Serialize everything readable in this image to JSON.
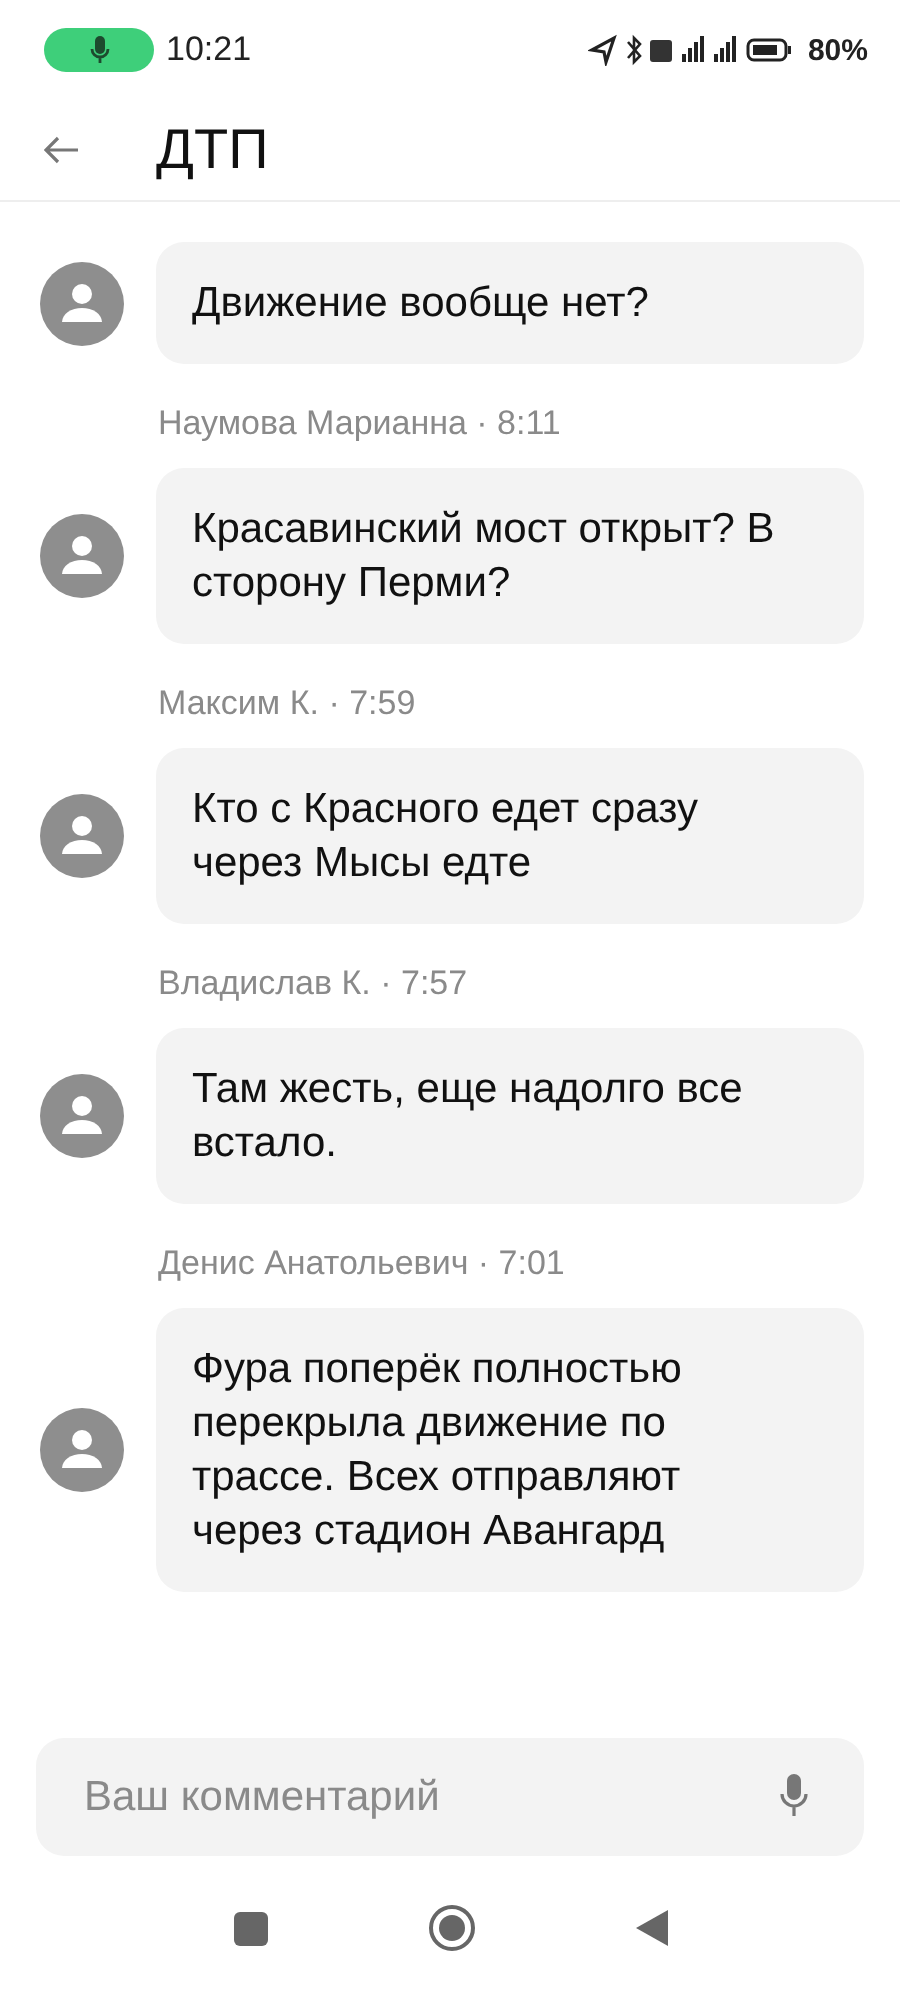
{
  "status_bar": {
    "time": "10:21",
    "battery": "80%",
    "mic_active": true
  },
  "header": {
    "title": "ДТП"
  },
  "comments": [
    {
      "text": "Движение вообще нет?"
    },
    {
      "author": "Наумова Марианна · 8:11",
      "text": "Красавинский мост открыт? В сторону Перми?"
    },
    {
      "author": "Максим К. · 7:59",
      "text": "Кто с Красного едет сразу через Мысы едте"
    },
    {
      "author": "Владислав К. · 7:57",
      "text": "Там жесть, еще надолго все встало."
    },
    {
      "author": "Денис Анатольевич · 7:01",
      "text": "Фура поперёк полностью перекрыла движение по трассе. Всех отправляют через стадион Авангард"
    }
  ],
  "comment_field": {
    "placeholder": "Ваш комментарий"
  }
}
